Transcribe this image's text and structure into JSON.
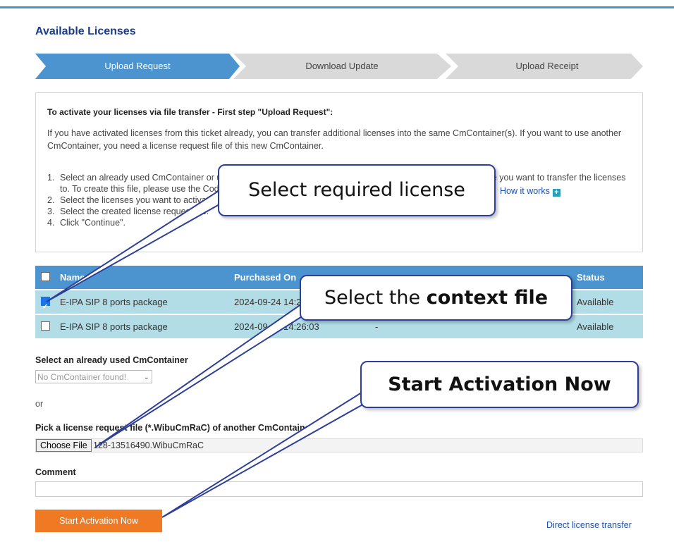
{
  "page": {
    "title": "Available Licenses"
  },
  "wizard": {
    "steps": [
      {
        "label": "Upload Request",
        "active": true
      },
      {
        "label": "Download Update",
        "active": false
      },
      {
        "label": "Upload Receipt",
        "active": false
      }
    ]
  },
  "info": {
    "heading": "To activate your licenses via file transfer - First step \"Upload Request\":",
    "paragraph": "If you have activated licenses from this ticket already, you can transfer additional licenses into the same CmContainer(s). If you want to use another CmContainer, you need a license request file of this new CmContainer.",
    "steps": [
      {
        "num": "1.",
        "text": "Select an already used CmContainer or upload a license request file (*.WibuCmRaC) of the CmContainer where you want to transfer the licenses to. To create this file, please use the CodeMeter License Central Web Depot."
      },
      {
        "num": "2.",
        "text": "Select the licenses you want to activate."
      },
      {
        "num": "3.",
        "text": "Select the created license request file."
      },
      {
        "num": "4.",
        "text": "Click \"Continue\"."
      }
    ],
    "how_link": "How it works"
  },
  "table": {
    "headers": {
      "name": "Name",
      "purchased": "Purchased On",
      "status": "Status"
    },
    "rows": [
      {
        "checked": true,
        "name": "E-IPA SIP 8 ports package",
        "purchased": "2024-09-24 14:26:03",
        "extra": "-",
        "status": "Available"
      },
      {
        "checked": false,
        "name": "E-IPA SIP 8 ports package",
        "purchased": "2024-09-24 14:26:03",
        "extra": "-",
        "status": "Available"
      }
    ]
  },
  "form": {
    "container_label": "Select an already used CmContainer",
    "container_value": "No CmContainer found!",
    "or_text": "or",
    "file_label": "Pick a license request file (*.WibuCmRaC) of another CmContainer",
    "choose_label": "Choose File",
    "file_name": "128-13516490.WibuCmRaC",
    "comment_label": "Comment",
    "start_label": "Start Activation Now",
    "direct_link": "Direct license transfer"
  },
  "callouts": {
    "select_license": "Select required license",
    "context_prefix": "Select the ",
    "context_bold": "context file",
    "start_now": "Start Activation Now"
  },
  "colors": {
    "accent": "#4b94cf",
    "row_bg": "#b3dde6",
    "start_button": "#f07a24",
    "link": "#1f4fa8",
    "callout_border": "#2e3f9a"
  }
}
